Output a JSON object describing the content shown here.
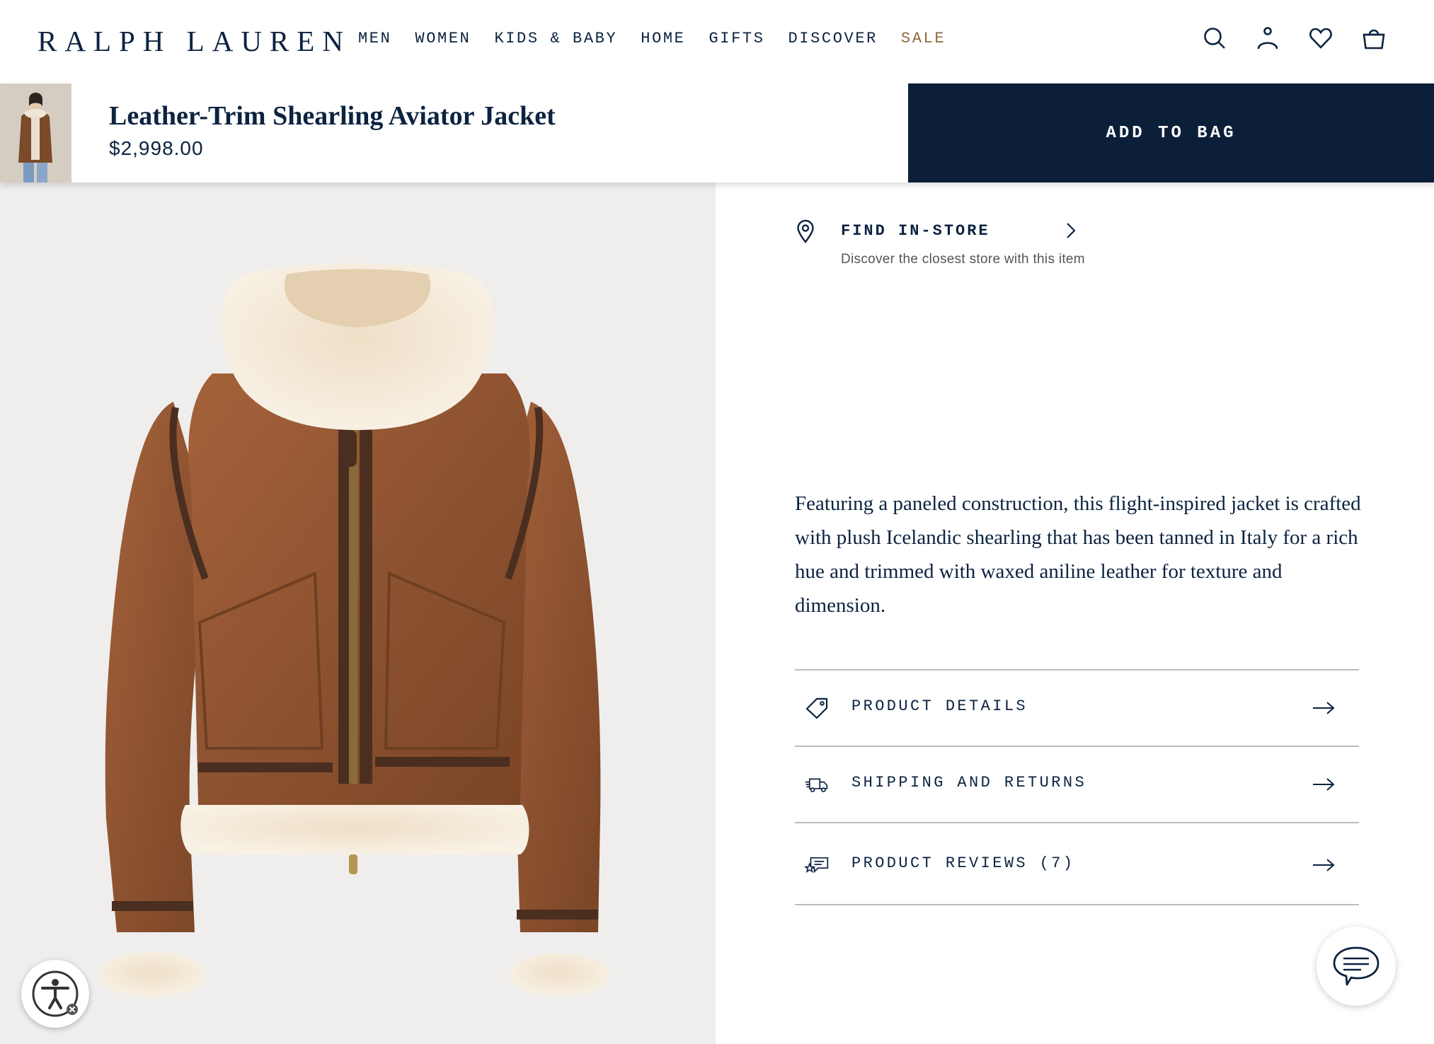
{
  "brand": {
    "logo_text": "RALPH LAUREN",
    "navy": "#0C2340",
    "sale_color": "#8C6A3C"
  },
  "nav": {
    "items": [
      {
        "label": "MEN"
      },
      {
        "label": "WOMEN"
      },
      {
        "label": "KIDS & BABY"
      },
      {
        "label": "HOME"
      },
      {
        "label": "GIFTS"
      },
      {
        "label": "DISCOVER"
      },
      {
        "label": "SALE"
      }
    ]
  },
  "header_icons": [
    "search-icon",
    "account-icon",
    "wishlist-heart-icon",
    "shopping-bag-icon"
  ],
  "product": {
    "title": "Leather-Trim Shearling Aviator Jacket",
    "price": "$2,998.00",
    "add_to_bag_label": "ADD TO BAG",
    "description": "Featuring a paneled construction, this flight-inspired jacket is crafted with plush Icelandic shearling that has been tanned in Italy for a rich hue and trimmed with waxed aniline leather for texture and dimension."
  },
  "find_store": {
    "label": "FIND IN-STORE",
    "subtext": "Discover the closest store with this item"
  },
  "accordion": [
    {
      "label": "PRODUCT DETAILS",
      "icon": "tag-icon"
    },
    {
      "label": "SHIPPING AND RETURNS",
      "icon": "truck-icon"
    },
    {
      "label": "PRODUCT REVIEWS (7)",
      "icon": "review-icon"
    }
  ],
  "widgets": {
    "accessibility_icon": "accessibility-icon",
    "chat_icon": "chat-icon"
  }
}
